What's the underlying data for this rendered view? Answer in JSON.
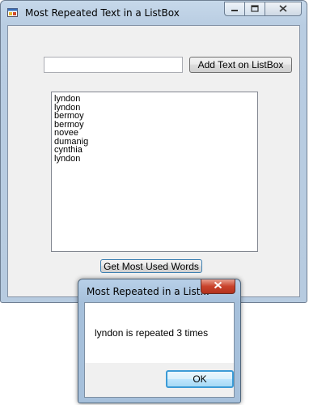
{
  "main_window": {
    "title": "Most Repeated Text in a ListBox",
    "text_input_value": "",
    "add_button_label": "Add Text on ListBox",
    "list_items": [
      "lyndon",
      "lyndon",
      "bermoy",
      "bermoy",
      "novee",
      "dumanig",
      "cynthia",
      "lyndon"
    ],
    "get_button_label": "Get Most Used Words"
  },
  "dialog": {
    "title": "Most Repeated in a List...",
    "message": "lyndon is repeated 3 times",
    "ok_label": "OK"
  }
}
